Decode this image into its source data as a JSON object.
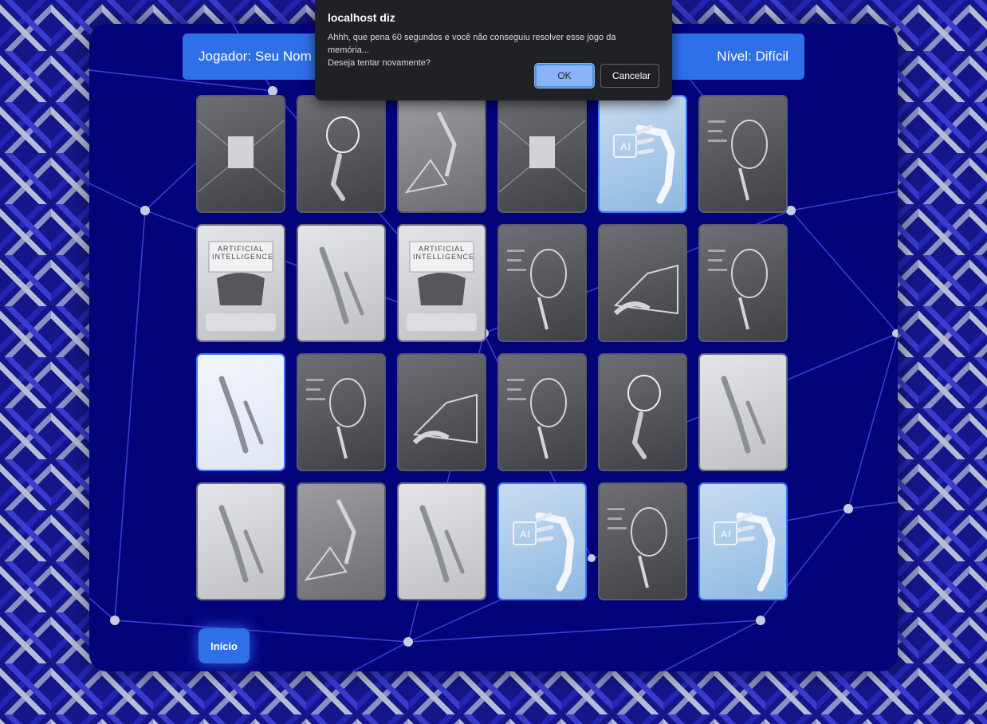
{
  "header": {
    "player_label": "Jogador: Seu Nom",
    "level_label": "Nível: Difícil"
  },
  "cards": [
    {
      "state": "hidden",
      "tone": "dark",
      "icon": "chip-city-icon"
    },
    {
      "state": "hidden",
      "tone": "dark",
      "icon": "robot-hand-brain-icon"
    },
    {
      "state": "hidden",
      "tone": "mid",
      "icon": "robot-piano-icon"
    },
    {
      "state": "hidden",
      "tone": "dark",
      "icon": "chip-city-icon"
    },
    {
      "state": "revealed",
      "tone": "blue",
      "icon": "ai-robot-hand-icon",
      "text": "AI"
    },
    {
      "state": "hidden",
      "tone": "dark",
      "icon": "android-face-icon"
    },
    {
      "state": "hidden",
      "tone": "light",
      "icon": "typewriter-icon",
      "text": "ARTIFICIAL INTELLIGENCE"
    },
    {
      "state": "hidden",
      "tone": "light",
      "icon": "robot-hand-phone-icon"
    },
    {
      "state": "hidden",
      "tone": "light",
      "icon": "typewriter-icon",
      "text": "ARTIFICIAL INTELLIGENCE"
    },
    {
      "state": "hidden",
      "tone": "dark",
      "icon": "circuit-head-icon"
    },
    {
      "state": "hidden",
      "tone": "dark",
      "icon": "laptop-hands-icon"
    },
    {
      "state": "hidden",
      "tone": "dark",
      "icon": "android-dark-icon"
    },
    {
      "state": "revealed",
      "tone": "white",
      "icon": "robot-finger-icon"
    },
    {
      "state": "hidden",
      "tone": "dark",
      "icon": "circuit-head-icon"
    },
    {
      "state": "hidden",
      "tone": "dark",
      "icon": "laptop-hands-icon"
    },
    {
      "state": "hidden",
      "tone": "dark",
      "icon": "android-face-icon"
    },
    {
      "state": "hidden",
      "tone": "dark",
      "icon": "robot-hand-brain-icon"
    },
    {
      "state": "hidden",
      "tone": "light",
      "icon": "robot-hand-table-icon"
    },
    {
      "state": "hidden",
      "tone": "light",
      "icon": "robot-hand-phone-icon"
    },
    {
      "state": "hidden",
      "tone": "mid",
      "icon": "robot-piano-icon"
    },
    {
      "state": "hidden",
      "tone": "light",
      "icon": "robot-hand-table-icon"
    },
    {
      "state": "revealed",
      "tone": "blue",
      "icon": "ai-robot-hand-icon",
      "text": "AI"
    },
    {
      "state": "hidden",
      "tone": "dark",
      "icon": "android-dark-icon"
    },
    {
      "state": "revealed",
      "tone": "blue",
      "icon": "ai-robot-hand-icon",
      "text": "AI"
    }
  ],
  "start_button": "Início",
  "dialog": {
    "title": "localhost diz",
    "message_line1": "Ahhh, que pena 60 segundos e você não conseguiu resolver esse jogo da memória...",
    "message_line2": "Deseja tentar novamente?",
    "ok_label": "OK",
    "cancel_label": "Cancelar"
  },
  "colors": {
    "panel": "#03037a",
    "accent": "#2f6fe8",
    "network_line": "#4a4ae8",
    "network_node": "#c9cbe0"
  }
}
